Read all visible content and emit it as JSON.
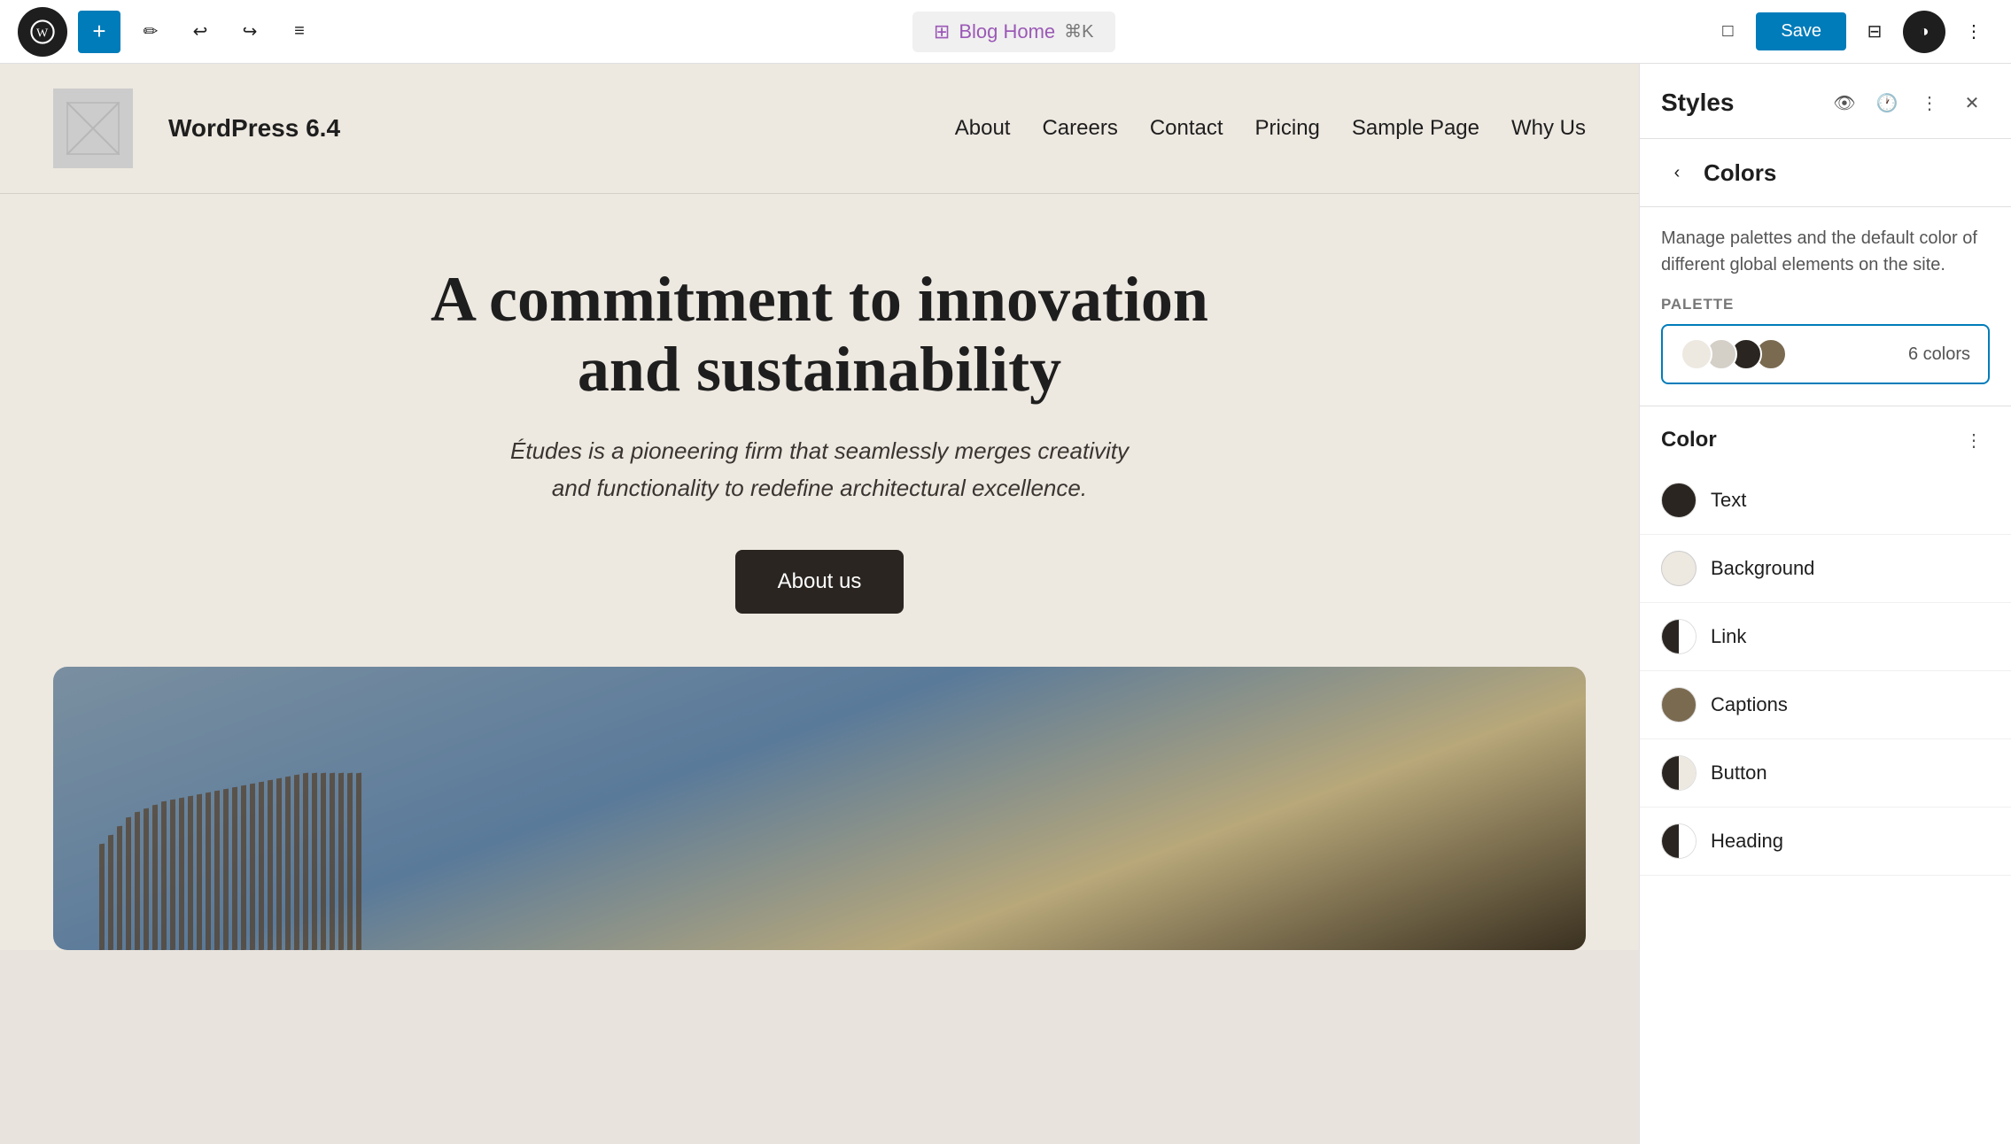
{
  "toolbar": {
    "add_label": "+",
    "wp_logo": "W",
    "undo_icon": "↩",
    "redo_icon": "↪",
    "list_icon": "≡",
    "blog_home_label": "Blog Home",
    "shortcut_label": "⌘K",
    "save_label": "Save",
    "layout_icon": "□",
    "style_icon": "◑",
    "more_icon": "⋯"
  },
  "canvas": {
    "site_name": "WordPress 6.4",
    "nav_items": [
      "About",
      "Careers",
      "Contact",
      "Pricing",
      "Sample Page",
      "Why Us"
    ],
    "hero_title": "A commitment to innovation and sustainability",
    "hero_subtitle": "Études is a pioneering firm that seamlessly merges creativity and functionality to redefine architectural excellence.",
    "hero_button": "About us"
  },
  "styles_panel": {
    "title": "Styles",
    "colors_title": "Colors",
    "description": "Manage palettes and the default color of different global elements on the site.",
    "palette_label": "PALETTE",
    "palette_count": "6 colors",
    "color_section_title": "Color",
    "color_items": [
      {
        "label": "Text",
        "type": "solid",
        "color": "#2a2520"
      },
      {
        "label": "Background",
        "type": "solid",
        "color": "#ede8e0"
      },
      {
        "label": "Link",
        "type": "half",
        "left": "#2a2520",
        "right": "#fff"
      },
      {
        "label": "Captions",
        "type": "solid",
        "color": "#7a6a50"
      },
      {
        "label": "Button",
        "type": "half",
        "left": "#2a2520",
        "right": "#ede8e0"
      },
      {
        "label": "Heading",
        "type": "half",
        "left": "#2a2520",
        "right": "#fff"
      }
    ],
    "swatches": [
      {
        "color": "#ede8e0"
      },
      {
        "color": "#d4cfc7"
      },
      {
        "color": "#2a2520"
      },
      {
        "color": "#7a6a50"
      }
    ]
  }
}
